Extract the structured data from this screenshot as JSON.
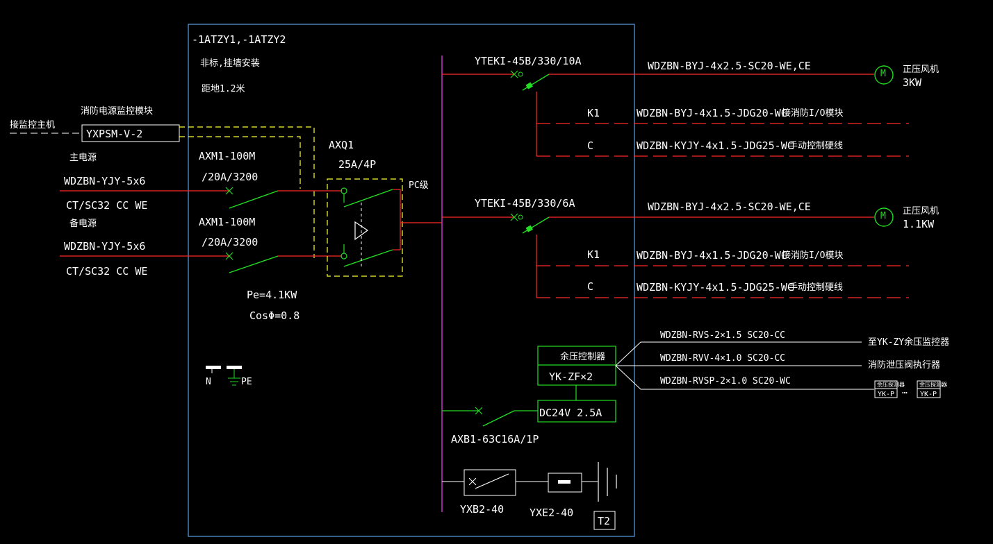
{
  "colors": {
    "background": "#000000",
    "panel": "#5aa0e6",
    "wire": "#ff2a2a",
    "switch": "#22dd22",
    "bus": "#cc33cc",
    "control": "#ffff33",
    "text": "#ffffff"
  },
  "panel": {
    "title": "-1ATZY1,-1ATZY2",
    "install": "非标,挂墙安装",
    "height": "距地1.2米"
  },
  "monitor": {
    "link_label": "接监控主机",
    "module_title": "消防电源监控模块",
    "module_model": "YXPSM-V-2"
  },
  "incoming": [
    {
      "title": "主电源",
      "cable": "WDZBN-YJY-5x6",
      "conduit": "CT/SC32 CC WE",
      "breaker": "AXM1-100M",
      "rating": "/20A/3200"
    },
    {
      "title": "备电源",
      "cable": "WDZBN-YJY-5x6",
      "conduit": "CT/SC32 CC WE",
      "breaker": "AXM1-100M",
      "rating": "/20A/3200"
    }
  ],
  "ats": {
    "name": "AXQ1",
    "rating": "25A/4P",
    "class": "PC级"
  },
  "load": {
    "pe": "Pe=4.1KW",
    "cos": "CosΦ=0.8"
  },
  "terminals": {
    "n": "N",
    "pe": "PE"
  },
  "branches": [
    {
      "breaker": "YTEKI-45B/330/10A",
      "cable": "WDZBN-BYJ-4x2.5-SC20-WE,CE",
      "motor_symbol": "M",
      "load_name": "正压风机",
      "load_power": "3KW",
      "ctrl": [
        {
          "tag": "K1",
          "cable": "WDZBN-BYJ-4x1.5-JDG20-WC",
          "note": "接消防I/O模块"
        },
        {
          "tag": "C",
          "cable": "WDZBN-KYJY-4x1.5-JDG25-WC",
          "note": "手动控制硬线"
        }
      ]
    },
    {
      "breaker": "YTEKI-45B/330/6A",
      "cable": "WDZBN-BYJ-4x2.5-SC20-WE,CE",
      "motor_symbol": "M",
      "load_name": "正压风机",
      "load_power": "1.1KW",
      "ctrl": [
        {
          "tag": "K1",
          "cable": "WDZBN-BYJ-4x1.5-JDG20-WC",
          "note": "接消防I/O模块"
        },
        {
          "tag": "C",
          "cable": "WDZBN-KYJY-4x1.5-JDG25-WC",
          "note": "手动控制硬线"
        }
      ]
    }
  ],
  "controller": {
    "title": "余压控制器",
    "model": "YK-ZF×2",
    "power": "DC24V 2.5A",
    "breaker": "AXB1-63C16A/1P",
    "cables": [
      "WDZBN-RVS-2×1.5 SC20-CC",
      "WDZBN-RVV-4×1.0 SC20-CC",
      "WDZBN-RVSP-2×1.0 SC20-WC"
    ],
    "targets": [
      "至YK-ZY余压监控器",
      "消防泄压阀执行器"
    ],
    "sensor_small": "余压探测器",
    "sensor_model": "YK-P",
    "dots": "…"
  },
  "spd": {
    "breaker": "YXB2-40",
    "spd": "YXE2-40",
    "type": "T2"
  }
}
